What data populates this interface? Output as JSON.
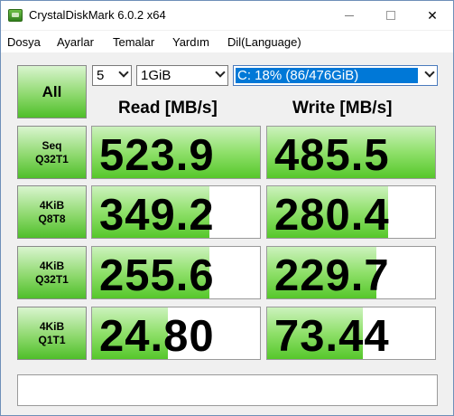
{
  "window": {
    "title": "CrystalDiskMark 6.0.2 x64"
  },
  "menu": [
    "Dosya",
    "Ayarlar",
    "Temalar",
    "Yardım",
    "Dil(Language)"
  ],
  "controls": {
    "all_label": "All",
    "count": "5",
    "size": "1GiB",
    "drive": "C: 18% (86/476GiB)"
  },
  "headers": {
    "read": "Read [MB/s]",
    "write": "Write [MB/s]"
  },
  "rows": [
    {
      "label1": "Seq",
      "label2": "Q32T1",
      "read": "523.9",
      "write": "485.5",
      "read_fill_pct": 100,
      "write_fill_pct": 100
    },
    {
      "label1": "4KiB",
      "label2": "Q8T8",
      "read": "349.2",
      "write": "280.4",
      "read_fill_pct": 70,
      "write_fill_pct": 72
    },
    {
      "label1": "4KiB",
      "label2": "Q32T1",
      "read": "255.6",
      "write": "229.7",
      "read_fill_pct": 70,
      "write_fill_pct": 65
    },
    {
      "label1": "4KiB",
      "label2": "Q1T1",
      "read": "24.80",
      "write": "73.44",
      "read_fill_pct": 45,
      "write_fill_pct": 57
    }
  ],
  "colors": {
    "accent_green": "#56c72b",
    "selection_blue": "#0078d7"
  }
}
